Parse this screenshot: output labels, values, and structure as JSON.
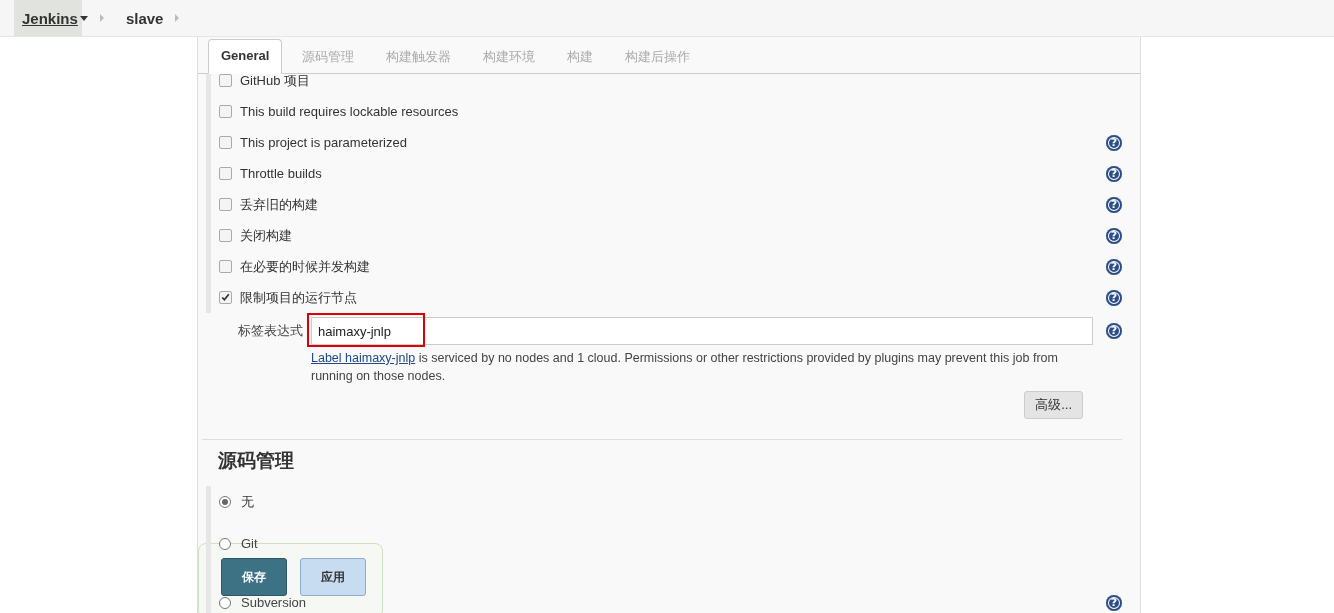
{
  "breadcrumbs": [
    {
      "label": "Jenkins",
      "dropdown": true
    },
    {
      "label": "slave",
      "dropdown": false
    }
  ],
  "tabs": [
    {
      "label": "General",
      "selected": true
    },
    {
      "label": "源码管理",
      "selected": false
    },
    {
      "label": "构建触发器",
      "selected": false
    },
    {
      "label": "构建环境",
      "selected": false
    },
    {
      "label": "构建",
      "selected": false
    },
    {
      "label": "构建后操作",
      "selected": false
    }
  ],
  "options": [
    {
      "label": "GitHub 项目",
      "checked": false
    },
    {
      "label": "This build requires lockable resources",
      "checked": false
    },
    {
      "label": "This project is parameterized",
      "checked": false,
      "help": "?"
    },
    {
      "label": "Throttle builds",
      "checked": false,
      "help": "?"
    },
    {
      "label": "丢弃旧的构建",
      "checked": false,
      "help": "?"
    },
    {
      "label": "关闭构建",
      "checked": false,
      "help": "?"
    },
    {
      "label": "在必要的时候并发构建",
      "checked": false,
      "help": "?"
    },
    {
      "label": "限制项目的运行节点",
      "checked": true,
      "help": "?"
    }
  ],
  "label_expression": {
    "label": "标签表达式",
    "value": "haimaxy-jnlp",
    "help": "?",
    "note_link": "Label haimaxy-jnlp",
    "note": " is serviced by no nodes and 1 cloud. Permissions or other restrictions provided by plugins may prevent this job from running on those nodes.",
    "advanced_button": "高级..."
  },
  "scm": {
    "title": "源码管理",
    "options": [
      {
        "label": "无",
        "selected": true
      },
      {
        "label": "Git",
        "selected": false
      },
      {
        "label": "Subversion",
        "selected": false,
        "help": "?"
      }
    ]
  },
  "buttons": {
    "save": "保存",
    "apply": "应用"
  }
}
